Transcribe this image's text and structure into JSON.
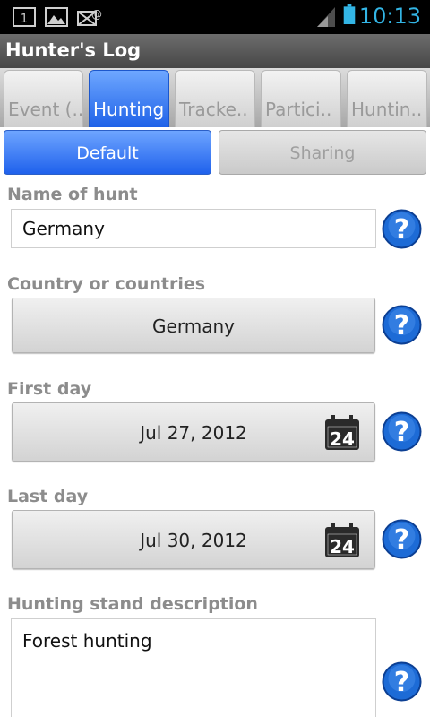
{
  "status_bar": {
    "time": "10:13",
    "notification_icons": [
      "sim-card-icon",
      "image-icon",
      "mail-alert-icon"
    ],
    "system_icons": [
      "signal-icon",
      "battery-icon"
    ]
  },
  "app": {
    "title": "Hunter's Log"
  },
  "tabs": [
    {
      "label": "Event (.."
    },
    {
      "label": "Hunting",
      "selected": true
    },
    {
      "label": "Tracke.."
    },
    {
      "label": "Partici.."
    },
    {
      "label": "Huntin.."
    }
  ],
  "segments": {
    "default_label": "Default",
    "sharing_label": "Sharing",
    "selected": "Default"
  },
  "form": {
    "name_of_hunt": {
      "label": "Name of hunt",
      "value": "Germany"
    },
    "countries": {
      "label": "Country or countries",
      "value": "Germany"
    },
    "first_day": {
      "label": "First day",
      "value": "Jul 27, 2012",
      "calendar_day": "24"
    },
    "last_day": {
      "label": "Last day",
      "value": "Jul 30, 2012",
      "calendar_day": "24"
    },
    "stand_description": {
      "label": "Hunting stand description",
      "value": "Forest hunting"
    }
  },
  "icons": {
    "help": "help-icon",
    "calendar": "calendar-icon"
  },
  "colors": {
    "accent_blue": "#1f62e8",
    "clock": "#33b5e5",
    "label_gray": "#8c8c8c"
  }
}
